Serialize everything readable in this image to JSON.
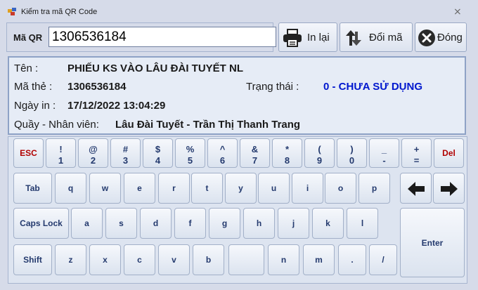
{
  "window": {
    "title": "Kiểm tra mã QR Code",
    "close_glyph": "⨯"
  },
  "qr": {
    "label": "Mã QR",
    "value": "1306536184"
  },
  "toolbar": {
    "print_label": "In lại",
    "exchange_label": "Đổi mã",
    "close_label": "Đóng"
  },
  "info": {
    "name_label": "Tên :",
    "name_value": "PHIẾU KS VÀO LÂU ĐÀI TUYẾT NL",
    "card_label": "Mã thẻ :",
    "card_value": "1306536184",
    "status_label": "Trạng thái :",
    "status_value": "0 - CHƯA SỬ DỤNG",
    "date_label": "Ngày in :",
    "date_value": "17/12/2022 13:04:29",
    "counter_label": "Quầy - Nhân viên:",
    "counter_value": "Lâu Đài Tuyết - Trần Thị Thanh Trang"
  },
  "keyboard": {
    "esc": "ESC",
    "del": "Del",
    "num": [
      {
        "top": "!",
        "bot": "1"
      },
      {
        "top": "@",
        "bot": "2"
      },
      {
        "top": "#",
        "bot": "3"
      },
      {
        "top": "$",
        "bot": "4"
      },
      {
        "top": "%",
        "bot": "5"
      },
      {
        "top": "^",
        "bot": "6"
      },
      {
        "top": "&",
        "bot": "7"
      },
      {
        "top": "*",
        "bot": "8"
      },
      {
        "top": "(",
        "bot": "9"
      },
      {
        "top": ")",
        "bot": "0"
      },
      {
        "top": "_",
        "bot": "-"
      },
      {
        "top": "+",
        "bot": "="
      }
    ],
    "tab": "Tab",
    "row_q": [
      "q",
      "w",
      "e",
      "r",
      "t",
      "y",
      "u",
      "i",
      "o",
      "p"
    ],
    "caps": "Caps Lock",
    "row_a": [
      "a",
      "s",
      "d",
      "f",
      "g",
      "h",
      "j",
      "k",
      "l"
    ],
    "enter": "Enter",
    "shift": "Shift",
    "row_z": [
      "z",
      "x",
      "c",
      "v",
      "b",
      "",
      "n",
      "m",
      ".",
      "/"
    ],
    "left_arrow": "🡄",
    "right_arrow": "🡆"
  },
  "colors": {
    "status": "#0017ce",
    "accent_red": "#b00000",
    "key_text": "#243a6e"
  },
  "icons": [
    "app-icon",
    "printer-icon",
    "exchange-icon",
    "close-circle-icon",
    "left-arrow-icon",
    "right-arrow-icon"
  ]
}
